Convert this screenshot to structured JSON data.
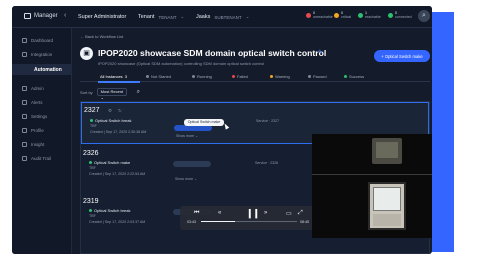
{
  "topbar": {
    "brand": "Manager",
    "user_role": "Super Administrator",
    "tenant_label": "Tenant",
    "tenant_value": "TENANT",
    "domain_label": "Jaaks",
    "domain_value": "SUBTENANT",
    "statuses": [
      {
        "count": "0",
        "label": "unreachable",
        "color": "#e5484d"
      },
      {
        "count": "0",
        "label": "critical",
        "color": "#f5a524"
      },
      {
        "count": "1",
        "label": "reachable",
        "color": "#2fbf71"
      },
      {
        "count": "0",
        "label": "connected",
        "color": "#2fbf71"
      }
    ]
  },
  "sidebar": {
    "items": [
      {
        "label": "Dashboard",
        "icon": "dashboard-icon"
      },
      {
        "label": "Integration",
        "icon": "integration-icon"
      },
      {
        "label": "Automation",
        "icon": "automation-icon",
        "active": true
      },
      {
        "label": "Admin",
        "icon": "admin-icon"
      },
      {
        "label": "Alerts",
        "icon": "alerts-icon"
      },
      {
        "label": "Settings",
        "icon": "settings-icon"
      },
      {
        "label": "Profile",
        "icon": "profile-icon"
      },
      {
        "label": "Insight",
        "icon": "insight-icon"
      },
      {
        "label": "Audit Trail",
        "icon": "audit-icon"
      }
    ]
  },
  "main": {
    "back_link": "← Back to Workflow List",
    "title": "IPOP2020 showcase SDM domain optical switch control",
    "subtitle": "IPOP2020 showcase (Optical SDM automation) controlling SDM domain optical switch control",
    "primary_button": "+ Optical Switch make",
    "tabs": [
      {
        "label": "All Instances",
        "count": "3",
        "active": true
      },
      {
        "label": "Not Started"
      },
      {
        "label": "Running"
      },
      {
        "label": "Failed"
      },
      {
        "label": "Warning"
      },
      {
        "label": "Paused"
      },
      {
        "label": "Success"
      }
    ],
    "sort_label": "Sort by",
    "sort_value": "Most Recent"
  },
  "instances": [
    {
      "id": "2327",
      "state": "Optical Switch break",
      "state_sub": "TBF",
      "started": "Created | Sep 17, 2020 2:30:38 AM",
      "service": "Service · 2327",
      "selected": true
    },
    {
      "id": "2326",
      "state": "Optical Switch make",
      "state_sub": "TBF",
      "started": "Created | Sep 17, 2020 2:22:54 AM",
      "service": "Service · 2326",
      "selected": false
    },
    {
      "id": "2319",
      "state": "Optical Switch break",
      "state_sub": "TBF",
      "started": "Created | Sep 17, 2020 2:03:37 AM",
      "service": "",
      "selected": false
    }
  ],
  "tooltip": "Optical Switch make",
  "more_label": "Show more ⌄",
  "player": {
    "time_current": "03:43",
    "time_total": "08:45",
    "progress": 0.35
  }
}
